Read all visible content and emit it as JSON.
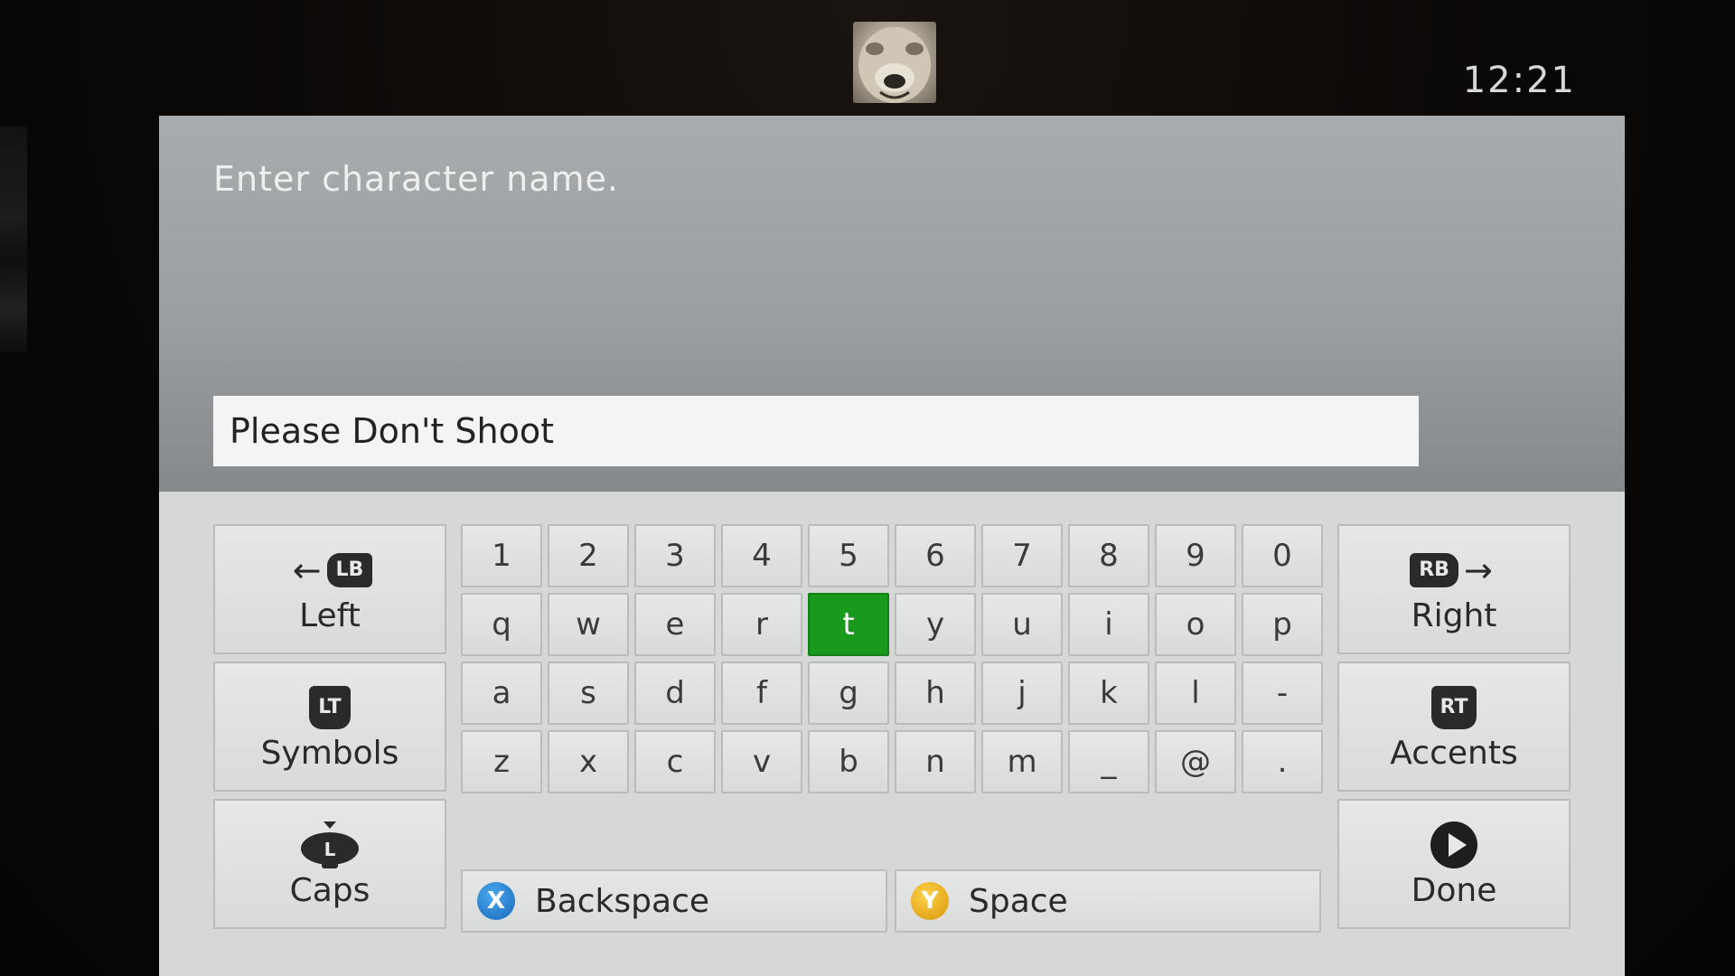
{
  "status": {
    "clock": "12:21"
  },
  "dialog": {
    "prompt": "Enter character name.",
    "input_value": "Please Don't Shoot"
  },
  "keyboard": {
    "selected_key": "t",
    "rows": [
      [
        "1",
        "2",
        "3",
        "4",
        "5",
        "6",
        "7",
        "8",
        "9",
        "0"
      ],
      [
        "q",
        "w",
        "e",
        "r",
        "t",
        "y",
        "u",
        "i",
        "o",
        "p"
      ],
      [
        "a",
        "s",
        "d",
        "f",
        "g",
        "h",
        "j",
        "k",
        "l",
        "-"
      ],
      [
        "z",
        "x",
        "c",
        "v",
        "b",
        "n",
        "m",
        "_",
        "@",
        "."
      ]
    ],
    "left": {
      "label": "Left",
      "bumper": "LB"
    },
    "right": {
      "label": "Right",
      "bumper": "RB"
    },
    "symbols": {
      "label": "Symbols",
      "trigger": "LT"
    },
    "accents": {
      "label": "Accents",
      "trigger": "RT"
    },
    "caps": {
      "label": "Caps",
      "stick": "L"
    },
    "done": {
      "label": "Done"
    },
    "backspace": {
      "label": "Backspace",
      "button": "X"
    },
    "space": {
      "label": "Space",
      "button": "Y"
    }
  },
  "colors": {
    "selected_key": "#1a9a1c",
    "x_button": "#1769b8",
    "y_button": "#d8950a"
  }
}
